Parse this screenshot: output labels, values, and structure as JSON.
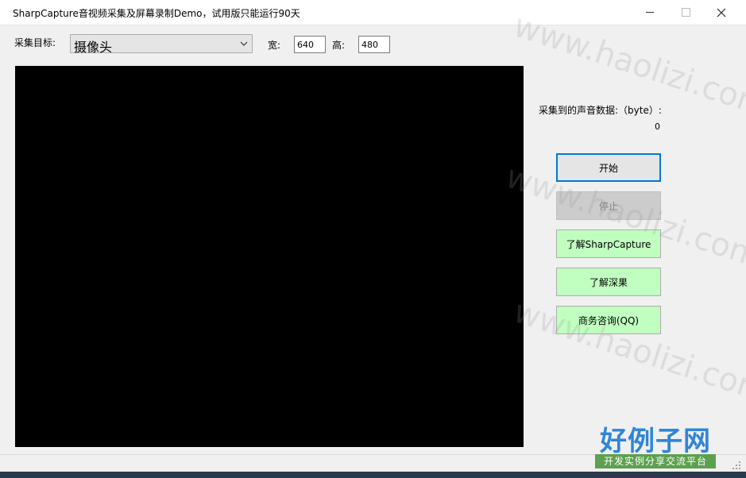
{
  "window": {
    "title": "SharpCapture音视频采集及屏幕录制Demo，试用版只能运行90天"
  },
  "capture": {
    "target_label": "采集目标:",
    "target_value": "摄像头",
    "width_label": "宽:",
    "width_value": "640",
    "height_label": "高:",
    "height_value": "480"
  },
  "audio": {
    "label": "采集到的声音数据:（byte）:",
    "value": "0"
  },
  "buttons": {
    "start": "开始",
    "stop": "停止",
    "learn_sharpcapture": "了解SharpCapture",
    "learn_oray": "了解深果",
    "business": "商务咨询(QQ)"
  },
  "watermark": {
    "text": "www.haolizi.com",
    "badge_title": "好例子网",
    "badge_subtitle": "开发实例分享交流平台"
  },
  "colors": {
    "accent": "#0078d7",
    "green_button": "#c0ffc0",
    "preview_bg": "#000000"
  }
}
